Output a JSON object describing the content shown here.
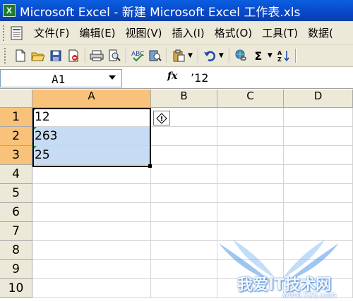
{
  "window": {
    "title": "Microsoft Excel - 新建 Microsoft Excel 工作表.xls",
    "app_icon_letter": "X"
  },
  "menu": {
    "items": [
      "文件(F)",
      "编辑(E)",
      "视图(V)",
      "插入(I)",
      "格式(O)",
      "工具(T)",
      "数据("
    ]
  },
  "toolbar": {
    "buttons": [
      "new-icon",
      "open-icon",
      "save-icon",
      "permission-icon",
      "print-icon",
      "print-preview-icon",
      "spelling-icon",
      "research-icon",
      "paste-icon",
      "undo-icon",
      "hyperlink-icon",
      "autosum-icon",
      "sort-ascending-icon"
    ],
    "autosum_label": "Σ"
  },
  "formula_bar": {
    "name_box": "A1",
    "fx_label": "fx",
    "content": "’12"
  },
  "sheet": {
    "columns": [
      "A",
      "B",
      "C",
      "D"
    ],
    "selected_column": "A",
    "rows": [
      "1",
      "2",
      "3",
      "4",
      "5",
      "6",
      "7",
      "8",
      "9",
      "10"
    ],
    "selected_rows": [
      "1",
      "2",
      "3"
    ],
    "cells": {
      "A1": "12",
      "A2": "263",
      "A3": "25"
    },
    "error_indicator": "!"
  },
  "watermark": {
    "text": "我爱IT技术网",
    "url": "www.52ij.com"
  },
  "colors": {
    "title_bar": "#0848c8",
    "selection": "#c7dcf4",
    "header_highlight": "#f8c27a",
    "error_triangle": "#1f8c3a"
  }
}
